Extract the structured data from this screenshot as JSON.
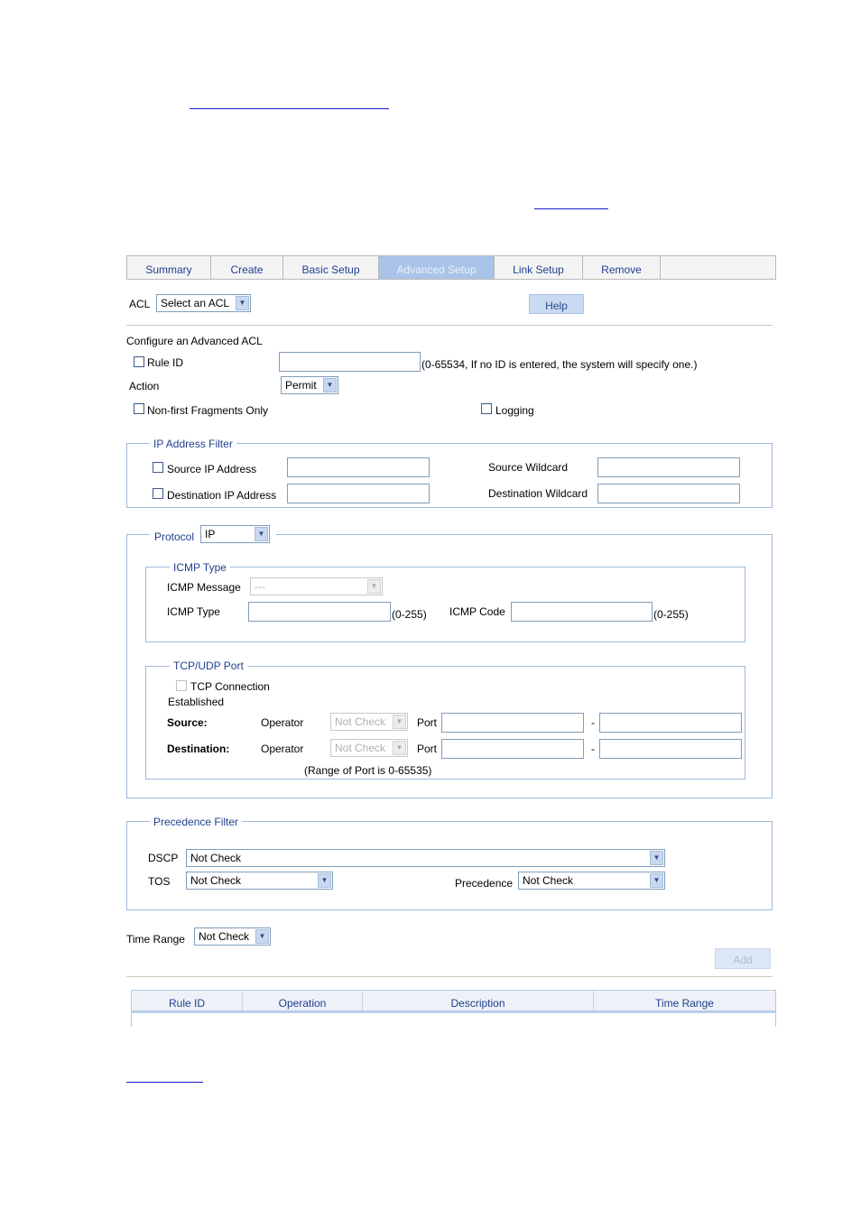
{
  "tabs": [
    "Summary",
    "Create",
    "Basic Setup",
    "Advanced Setup",
    "Link Setup",
    "Remove"
  ],
  "acl": {
    "label": "ACL",
    "value": "Select an ACL",
    "help": "Help"
  },
  "config": {
    "title": "Configure an Advanced ACL",
    "rule_id_label": "Rule ID",
    "rule_id_hint": "(0-65534, If no ID is entered, the system will specify one.)",
    "action_label": "Action",
    "action_value": "Permit",
    "nonfirst_label": "Non-first Fragments Only",
    "logging_label": "Logging"
  },
  "ip_filter": {
    "legend": "IP Address Filter",
    "src_ip_label": "Source IP Address",
    "dst_ip_label": "Destination IP Address",
    "src_wildcard_label": "Source Wildcard",
    "dst_wildcard_label": "Destination Wildcard"
  },
  "protocol": {
    "label": "Protocol",
    "value": "IP",
    "icmp": {
      "legend": "ICMP Type",
      "message_label": "ICMP Message",
      "message_value": "---",
      "type_label": "ICMP Type",
      "type_range": "(0-255)",
      "code_label": "ICMP Code",
      "code_range": "(0-255)"
    },
    "tcpudp": {
      "legend": "TCP/UDP Port",
      "established_line1": "TCP Connection",
      "established_line2": "Established",
      "source_label": "Source:",
      "destination_label": "Destination:",
      "operator_label": "Operator",
      "operator_value": "Not Check",
      "port_label": "Port",
      "dash": "-",
      "range_note": "(Range of Port is 0-65535)"
    }
  },
  "precedence": {
    "legend": "Precedence Filter",
    "dscp_label": "DSCP",
    "dscp_value": "Not Check",
    "tos_label": "TOS",
    "tos_value": "Not Check",
    "prec_label": "Precedence",
    "prec_value": "Not Check"
  },
  "time_range": {
    "label": "Time Range",
    "value": "Not Check"
  },
  "add_button": "Add",
  "table": {
    "columns": [
      "Rule ID",
      "Operation",
      "Description",
      "Time Range"
    ]
  }
}
